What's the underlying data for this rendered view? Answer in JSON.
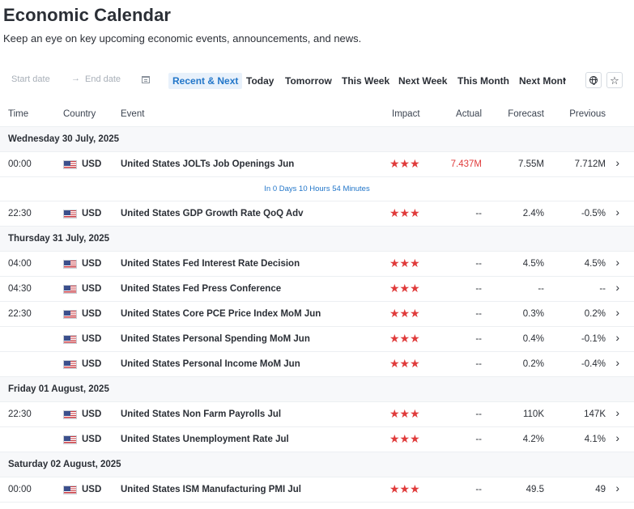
{
  "header": {
    "title": "Economic Calendar",
    "subtitle": "Keep an eye on key upcoming economic events, announcements, and news."
  },
  "filters": {
    "start_placeholder": "Start date",
    "arrow": "→",
    "end_placeholder": "End date",
    "tabs": [
      "Recent & Next",
      "Today",
      "Tomorrow",
      "This Week",
      "Next Week",
      "This Month",
      "Next Month"
    ],
    "active_tab": "Recent & Next",
    "tabs_more": "›"
  },
  "table": {
    "columns": {
      "time": "Time",
      "country": "Country",
      "event": "Event",
      "impact": "Impact",
      "actual": "Actual",
      "forecast": "Forecast",
      "previous": "Previous"
    },
    "groups": [
      {
        "date": "Wednesday 30 July, 2025",
        "rows": [
          {
            "time": "00:00",
            "currency": "USD",
            "event": "United States JOLTs Job Openings Jun",
            "impact": "★★★",
            "actual": "7.437M",
            "forecast": "7.55M",
            "previous": "7.712M",
            "chev": "›"
          },
          {
            "countdown": "In 0 Days 10 Hours 54 Minutes"
          },
          {
            "time": "22:30",
            "currency": "USD",
            "event": "United States GDP Growth Rate QoQ Adv",
            "impact": "★★★",
            "actual": "--",
            "forecast": "2.4%",
            "previous": "-0.5%",
            "chev": "›"
          }
        ]
      },
      {
        "date": "Thursday 31 July, 2025",
        "rows": [
          {
            "time": "04:00",
            "currency": "USD",
            "event": "United States Fed Interest Rate Decision",
            "impact": "★★★",
            "actual": "--",
            "forecast": "4.5%",
            "previous": "4.5%",
            "chev": "›"
          },
          {
            "time": "04:30",
            "currency": "USD",
            "event": "United States Fed Press Conference",
            "impact": "★★★",
            "actual": "--",
            "forecast": "--",
            "previous": "--",
            "chev": "›"
          },
          {
            "time": "22:30",
            "currency": "USD",
            "event": "United States Core PCE Price Index MoM Jun",
            "impact": "★★★",
            "actual": "--",
            "forecast": "0.3%",
            "previous": "0.2%",
            "chev": "›"
          },
          {
            "time": "",
            "currency": "USD",
            "event": "United States Personal Spending MoM Jun",
            "impact": "★★★",
            "actual": "--",
            "forecast": "0.4%",
            "previous": "-0.1%",
            "chev": "›"
          },
          {
            "time": "",
            "currency": "USD",
            "event": "United States Personal Income MoM Jun",
            "impact": "★★★",
            "actual": "--",
            "forecast": "0.2%",
            "previous": "-0.4%",
            "chev": "›"
          }
        ]
      },
      {
        "date": "Friday 01 August, 2025",
        "rows": [
          {
            "time": "22:30",
            "currency": "USD",
            "event": "United States Non Farm Payrolls Jul",
            "impact": "★★★",
            "actual": "--",
            "forecast": "110K",
            "previous": "147K",
            "chev": "›"
          },
          {
            "time": "",
            "currency": "USD",
            "event": "United States Unemployment Rate Jul",
            "impact": "★★★",
            "actual": "--",
            "forecast": "4.2%",
            "previous": "4.1%",
            "chev": "›"
          }
        ]
      },
      {
        "date": "Saturday 02 August, 2025",
        "rows": [
          {
            "time": "00:00",
            "currency": "USD",
            "event": "United States ISM Manufacturing PMI Jul",
            "impact": "★★★",
            "actual": "--",
            "forecast": "49.5",
            "previous": "49",
            "chev": "›"
          }
        ]
      }
    ]
  },
  "colors": {
    "accent": "#2276c9",
    "impact_star": "#e03b3b",
    "actual_highlight": "#e03b3b",
    "group_bg": "#f7f8fa"
  },
  "icons": {
    "date_picker": "calendar-icon",
    "timezone": "globe-icon",
    "favorites": "star-outline-icon",
    "row_expand": "chevron-right-icon"
  }
}
